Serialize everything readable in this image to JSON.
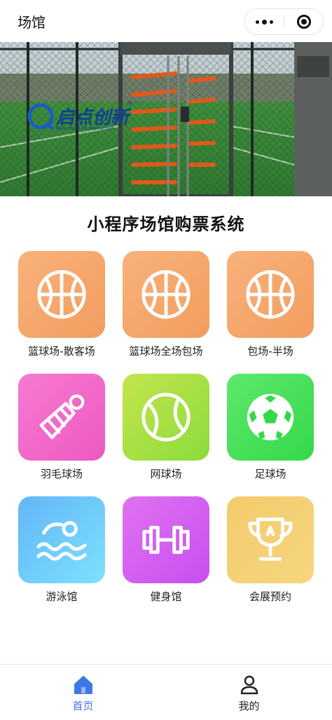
{
  "navbar": {
    "title": "场馆",
    "menu_icon": "more-dots-icon",
    "close_icon": "target-circle-icon"
  },
  "banner": {
    "logo_text": "启点创新",
    "logo_subtitle": "REAL POINT OF INNOVATION",
    "logo_mark": "®"
  },
  "page_title": "小程序场馆购票系统",
  "colors": {
    "accent_blue": "#3d78e6",
    "orange": "#f29d5e",
    "pink": "#ee59c0",
    "lime": "#a8df44",
    "green": "#34d84b",
    "blue": "#6cc8fb",
    "purple": "#d35ff0",
    "gold": "#f3cb6b"
  },
  "venues": [
    {
      "label": "篮球场-散客场",
      "icon": "basketball-icon"
    },
    {
      "label": "篮球场全场包场",
      "icon": "basketball-icon"
    },
    {
      "label": "包场-半场",
      "icon": "basketball-icon"
    },
    {
      "label": "羽毛球场",
      "icon": "shuttlecock-icon"
    },
    {
      "label": "网球场",
      "icon": "tennis-ball-icon"
    },
    {
      "label": "足球场",
      "icon": "soccer-ball-icon"
    },
    {
      "label": "游泳馆",
      "icon": "swimmer-icon"
    },
    {
      "label": "健身馆",
      "icon": "dumbbell-icon"
    },
    {
      "label": "会展预约",
      "icon": "trophy-icon"
    }
  ],
  "tabbar": {
    "items": [
      {
        "label": "首页",
        "icon": "home-icon",
        "active": true
      },
      {
        "label": "我的",
        "icon": "user-icon",
        "active": false
      }
    ]
  }
}
